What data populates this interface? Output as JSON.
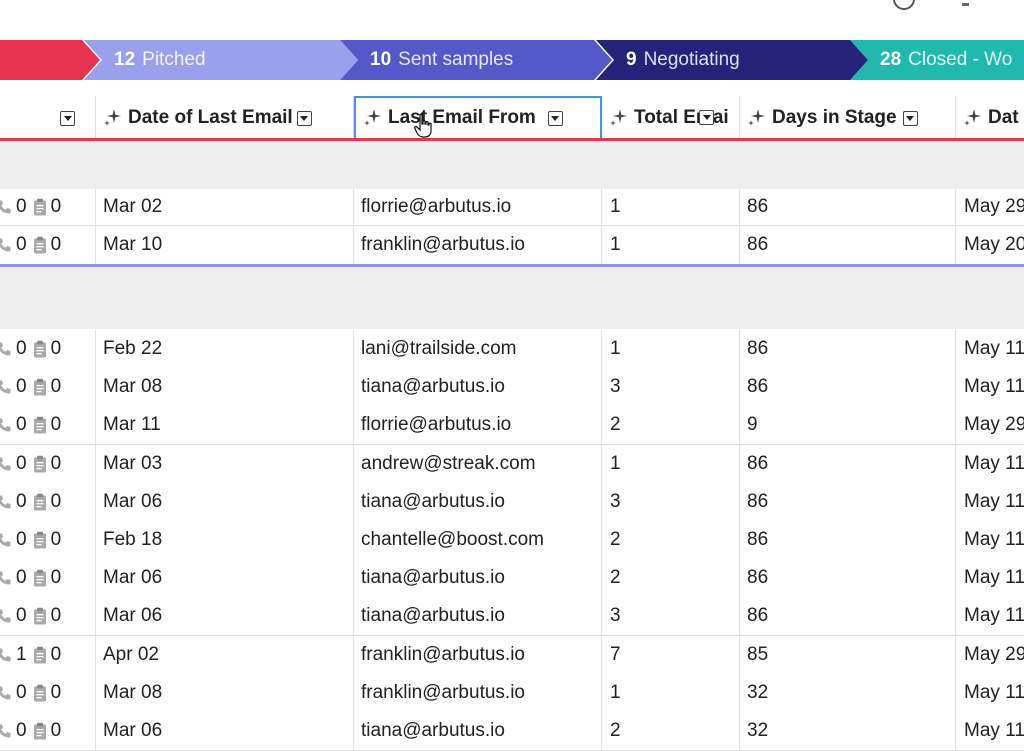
{
  "stages": [
    {
      "count": "",
      "name": ""
    },
    {
      "count": "12",
      "name": "Pitched"
    },
    {
      "count": "10",
      "name": "Sent samples"
    },
    {
      "count": "9",
      "name": "Negotiating"
    },
    {
      "count": "28",
      "name": "Closed - Wo"
    }
  ],
  "colors": {
    "stage_red": "#e8334f",
    "stage_pitched": "#9aa0ec",
    "stage_sent": "#5558c8",
    "stage_negotiating": "#23237a",
    "stage_closed": "#23b8ad",
    "selection": "#4a8fe0"
  },
  "columns": {
    "date": "Date of Last Email",
    "from": "Last Email From",
    "total": "Total Emai",
    "days": "Days in Stage",
    "next": "Dat"
  },
  "group_a_rows": [
    {
      "calls": "0",
      "tasks": "0",
      "date": "Mar 02",
      "from": "florrie@arbutus.io",
      "total": "1",
      "days": "86",
      "next": "May 29"
    },
    {
      "calls": "0",
      "tasks": "0",
      "date": "Mar 10",
      "from": "franklin@arbutus.io",
      "total": "1",
      "days": "86",
      "next": "May 20"
    }
  ],
  "group_b_rows": [
    {
      "calls": "0",
      "tasks": "0",
      "date": "Feb 22",
      "from": "lani@trailside.com",
      "total": "1",
      "days": "86",
      "next": "May 11"
    },
    {
      "calls": "0",
      "tasks": "0",
      "date": "Mar 08",
      "from": "tiana@arbutus.io",
      "total": "3",
      "days": "86",
      "next": "May 11"
    },
    {
      "calls": "0",
      "tasks": "0",
      "date": "Mar 11",
      "from": "florrie@arbutus.io",
      "total": "2",
      "days": "9",
      "next": "May 29"
    },
    {
      "calls": "0",
      "tasks": "0",
      "date": "Mar 03",
      "from": "andrew@streak.com",
      "total": "1",
      "days": "86",
      "next": "May 11"
    },
    {
      "calls": "0",
      "tasks": "0",
      "date": "Mar 06",
      "from": "tiana@arbutus.io",
      "total": "3",
      "days": "86",
      "next": "May 11"
    },
    {
      "calls": "0",
      "tasks": "0",
      "date": "Feb 18",
      "from": "chantelle@boost.com",
      "total": "2",
      "days": "86",
      "next": "May 11"
    },
    {
      "calls": "0",
      "tasks": "0",
      "date": "Mar 06",
      "from": "tiana@arbutus.io",
      "total": "2",
      "days": "86",
      "next": "May 11"
    },
    {
      "calls": "0",
      "tasks": "0",
      "date": "Mar 06",
      "from": "tiana@arbutus.io",
      "total": "3",
      "days": "86",
      "next": "May 11"
    },
    {
      "calls": "1",
      "tasks": "0",
      "date": "Apr 02",
      "from": "franklin@arbutus.io",
      "total": "7",
      "days": "85",
      "next": "May 29"
    },
    {
      "calls": "0",
      "tasks": "0",
      "date": "Mar 08",
      "from": "franklin@arbutus.io",
      "total": "1",
      "days": "32",
      "next": "May 11"
    },
    {
      "calls": "0",
      "tasks": "0",
      "date": "Mar 06",
      "from": "tiana@arbutus.io",
      "total": "2",
      "days": "32",
      "next": "May 11"
    }
  ],
  "icons": {
    "dropdown": "chevron-down-icon",
    "ai_field": "sparkle-icon",
    "calls": "phone-icon",
    "tasks": "clipboard-icon",
    "cursor": "hand-pointer-icon"
  }
}
